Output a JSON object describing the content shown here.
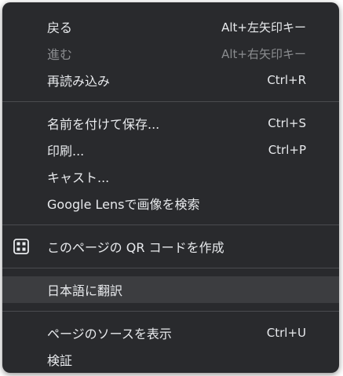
{
  "menu": {
    "groups": [
      {
        "items": [
          {
            "label": "戻る",
            "shortcut": "Alt+左矢印キー",
            "disabled": false
          },
          {
            "label": "進む",
            "shortcut": "Alt+右矢印キー",
            "disabled": true
          },
          {
            "label": "再読み込み",
            "shortcut": "Ctrl+R",
            "disabled": false
          }
        ]
      },
      {
        "items": [
          {
            "label": "名前を付けて保存...",
            "shortcut": "Ctrl+S"
          },
          {
            "label": "印刷...",
            "shortcut": "Ctrl+P"
          },
          {
            "label": "キャスト...",
            "shortcut": ""
          },
          {
            "label": "Google Lensで画像を検索",
            "shortcut": ""
          }
        ]
      },
      {
        "items": [
          {
            "label": "このページの QR コードを作成",
            "shortcut": "",
            "icon": "qr-code-icon"
          }
        ]
      },
      {
        "items": [
          {
            "label": "日本語に翻訳",
            "shortcut": "",
            "highlighted": true
          }
        ]
      },
      {
        "items": [
          {
            "label": "ページのソースを表示",
            "shortcut": "Ctrl+U"
          },
          {
            "label": "検証",
            "shortcut": ""
          }
        ]
      }
    ]
  },
  "colors": {
    "menu_bg": "#292a2d",
    "text": "#e8eaed",
    "disabled_text": "#8a8c8f",
    "highlight_bg": "#3c3d40",
    "separator": "#4a4b4f"
  }
}
